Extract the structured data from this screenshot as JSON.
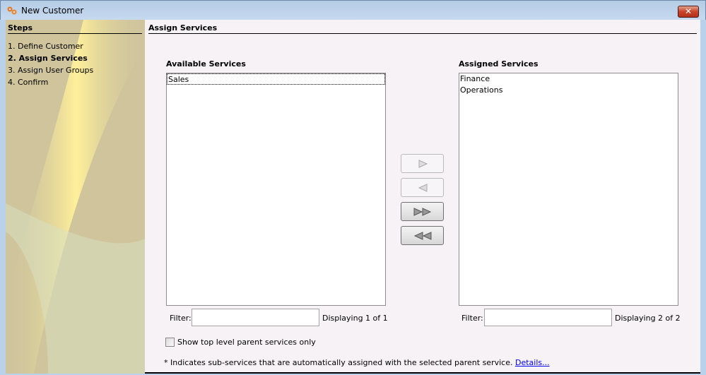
{
  "window": {
    "title": "New Customer",
    "close": "✕"
  },
  "steps": {
    "heading": "Steps",
    "items": [
      "1. Define Customer",
      "2. Assign Services",
      "3. Assign User Groups",
      "4. Confirm"
    ],
    "current": 1
  },
  "main": {
    "title": "Assign Services",
    "available": {
      "label": "Available Services",
      "items": [
        "Sales"
      ],
      "filter_label": "Filter:",
      "filter_value": "",
      "count": "Displaying 1 of 1"
    },
    "assigned": {
      "label": "Assigned Services",
      "items": [
        "Finance",
        "Operations"
      ],
      "filter_label": "Filter:",
      "filter_value": "",
      "count": "Displaying 2 of 2"
    },
    "checkbox_label": "Show top level parent services only",
    "note": "* Indicates sub-services that are automatically assigned with the selected parent service.",
    "details_link": "Details..."
  }
}
